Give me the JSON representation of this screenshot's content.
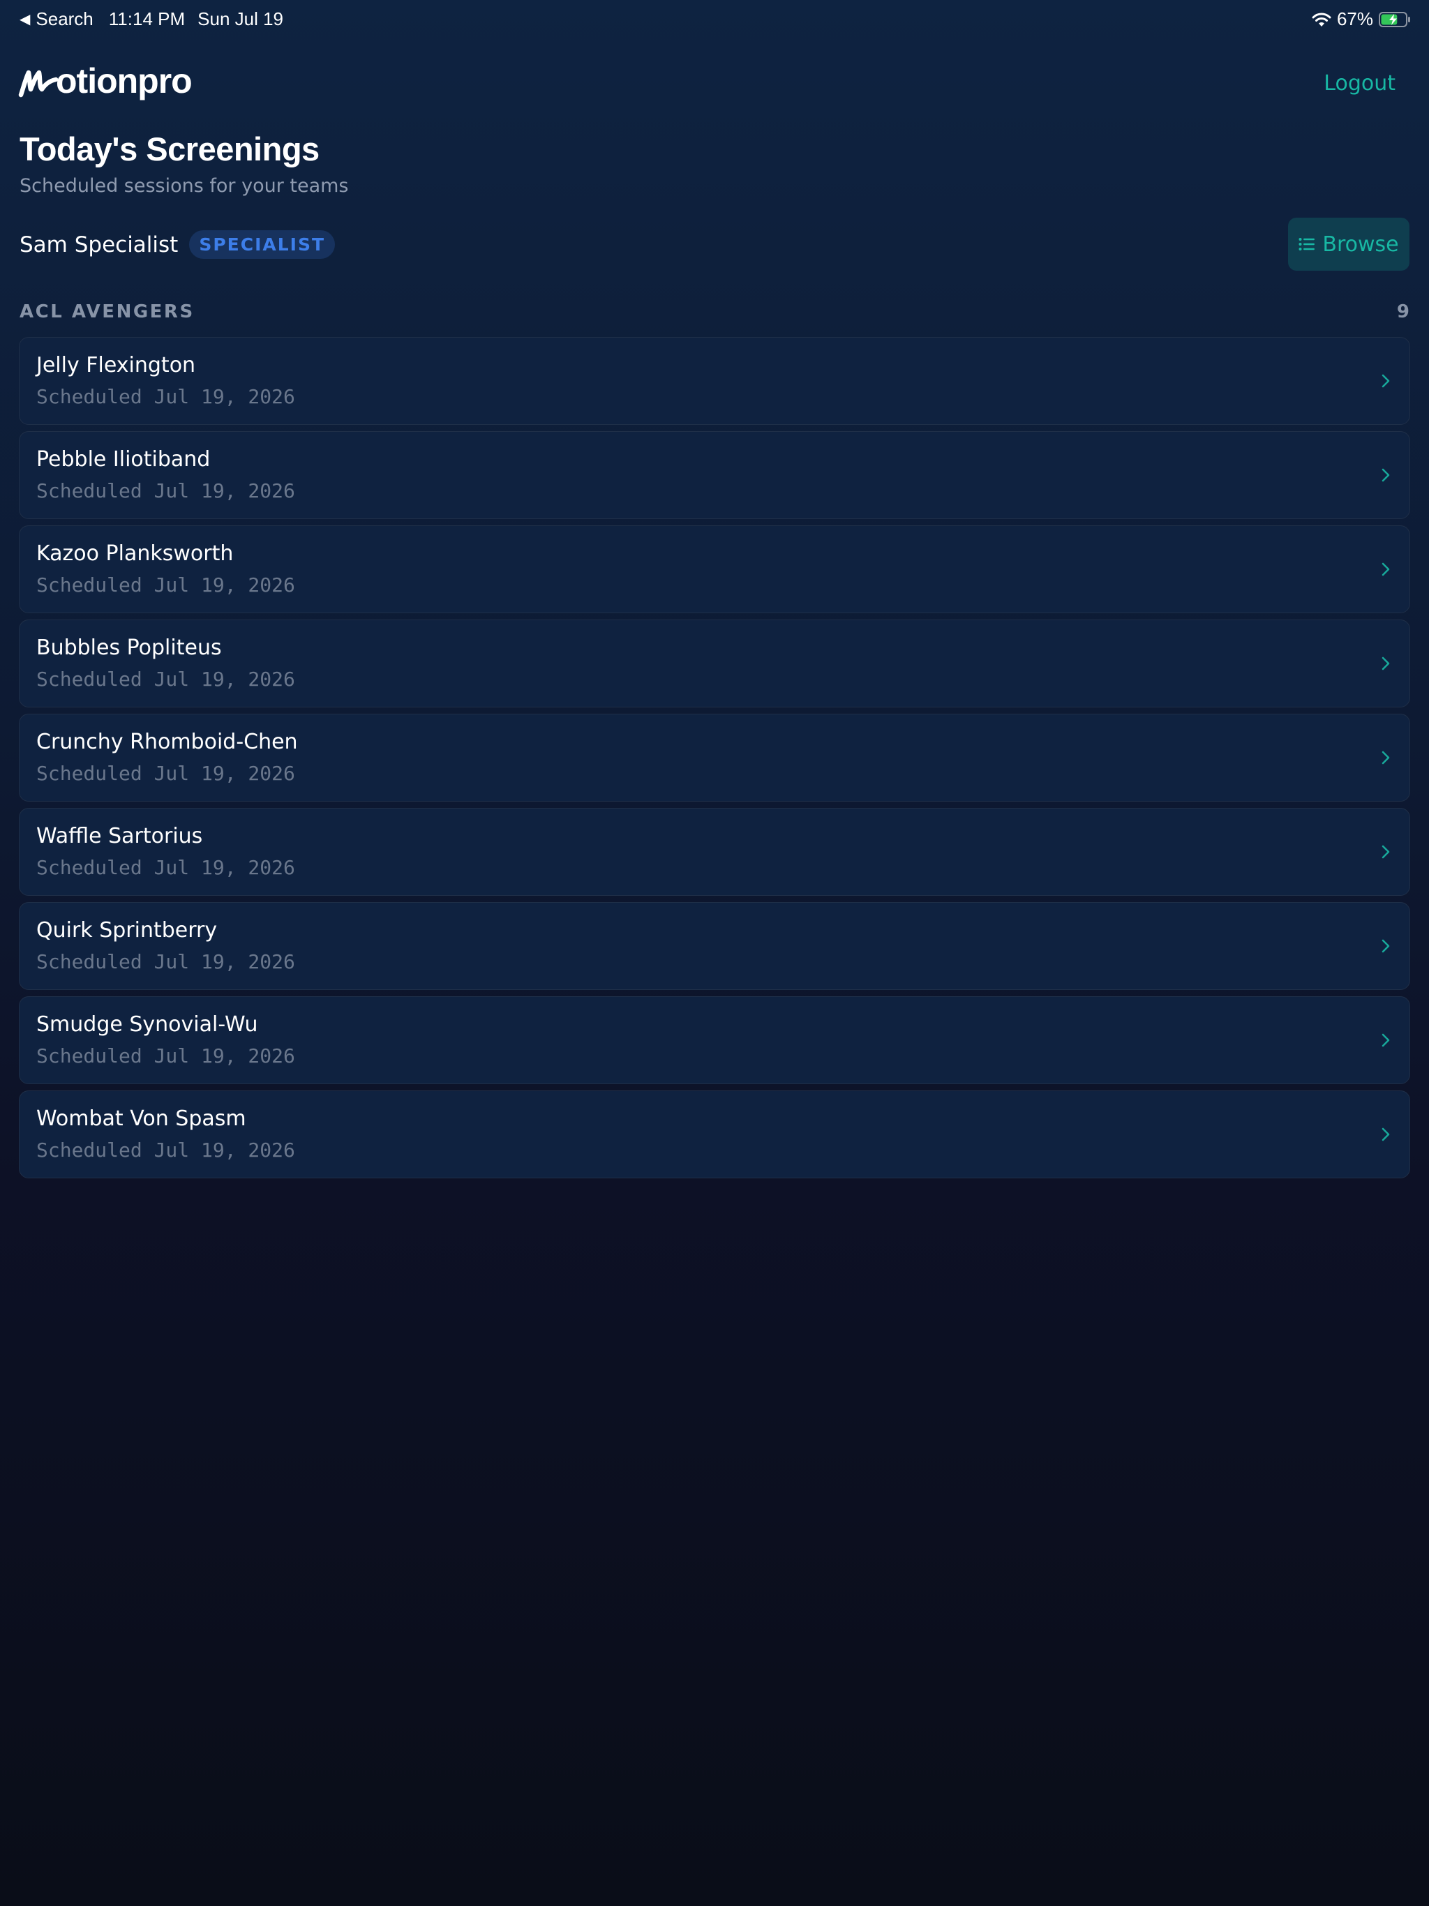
{
  "status_bar": {
    "back_label": "Search",
    "time": "11:14 PM",
    "date": "Sun Jul 19",
    "battery_percent": "67%",
    "battery_level": 0.67,
    "battery_charging": true,
    "icons": [
      "back-caret-icon",
      "wifi-icon",
      "battery-charging-icon"
    ]
  },
  "header": {
    "logo_text": "otionpro",
    "logout_label": "Logout"
  },
  "page": {
    "title": "Today's Screenings",
    "subtitle": "Scheduled sessions for your teams"
  },
  "user": {
    "name": "Sam Specialist",
    "role_badge": "SPECIALIST"
  },
  "browse_button": {
    "label": "Browse",
    "icon": "list-icon"
  },
  "team": {
    "name": "ACL AVENGERS",
    "count": "9",
    "players": [
      {
        "name": "Jelly Flexington",
        "scheduled": "Scheduled Jul 19, 2026"
      },
      {
        "name": "Pebble Iliotiband",
        "scheduled": "Scheduled Jul 19, 2026"
      },
      {
        "name": "Kazoo Planksworth",
        "scheduled": "Scheduled Jul 19, 2026"
      },
      {
        "name": "Bubbles Popliteus",
        "scheduled": "Scheduled Jul 19, 2026"
      },
      {
        "name": "Crunchy Rhomboid-Chen",
        "scheduled": "Scheduled Jul 19, 2026"
      },
      {
        "name": "Waffle Sartorius",
        "scheduled": "Scheduled Jul 19, 2026"
      },
      {
        "name": "Quirk Sprintberry",
        "scheduled": "Scheduled Jul 19, 2026"
      },
      {
        "name": "Smudge Synovial-Wu",
        "scheduled": "Scheduled Jul 19, 2026"
      },
      {
        "name": "Wombat Von Spasm",
        "scheduled": "Scheduled Jul 19, 2026"
      }
    ]
  },
  "colors": {
    "accent": "#18b8a4",
    "badge_text": "#3d7ee9",
    "badge_bg": "#17325e",
    "card_bg": "#0f2240",
    "muted_text": "#8f9bb0",
    "battery_fill": "#34c759"
  }
}
